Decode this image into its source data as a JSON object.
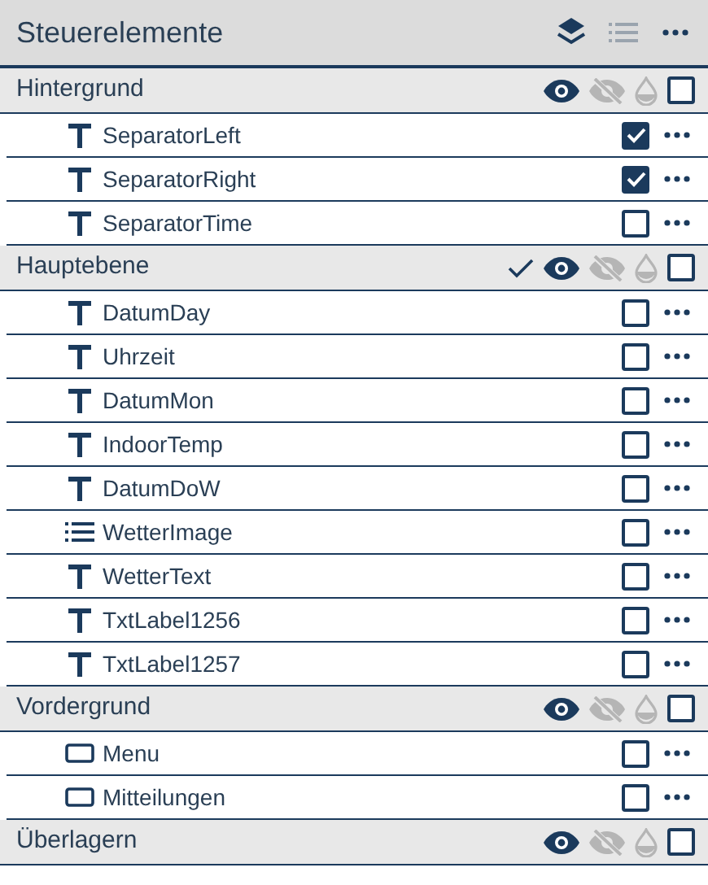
{
  "panel": {
    "title": "Steuerelemente",
    "view_modes": [
      {
        "kind": "layers",
        "selected": true
      },
      {
        "kind": "list",
        "selected": false
      }
    ]
  },
  "groups": [
    {
      "name": "Hintergrund",
      "active": false,
      "visible": true,
      "hidden": false,
      "checked": false,
      "items": [
        {
          "name": "SeparatorLeft",
          "kind": "text",
          "checked": true
        },
        {
          "name": "SeparatorRight",
          "kind": "text",
          "checked": true
        },
        {
          "name": "SeparatorTime",
          "kind": "text",
          "checked": false
        }
      ]
    },
    {
      "name": "Hauptebene",
      "active": true,
      "visible": true,
      "hidden": false,
      "checked": false,
      "items": [
        {
          "name": "DatumDay",
          "kind": "text",
          "checked": false
        },
        {
          "name": "Uhrzeit",
          "kind": "text",
          "checked": false
        },
        {
          "name": "DatumMon",
          "kind": "text",
          "checked": false
        },
        {
          "name": "IndoorTemp",
          "kind": "text",
          "checked": false
        },
        {
          "name": "DatumDoW",
          "kind": "text",
          "checked": false
        },
        {
          "name": "WetterImage",
          "kind": "list",
          "checked": false
        },
        {
          "name": "WetterText",
          "kind": "text",
          "checked": false
        },
        {
          "name": "TxtLabel1256",
          "kind": "text",
          "checked": false
        },
        {
          "name": "TxtLabel1257",
          "kind": "text",
          "checked": false
        }
      ]
    },
    {
      "name": "Vordergrund",
      "active": false,
      "visible": true,
      "hidden": false,
      "checked": false,
      "items": [
        {
          "name": "Menu",
          "kind": "container",
          "checked": false
        },
        {
          "name": "Mitteilungen",
          "kind": "container",
          "checked": false
        }
      ]
    },
    {
      "name": "Überlagern",
      "active": false,
      "visible": true,
      "hidden": false,
      "checked": false
    }
  ]
}
